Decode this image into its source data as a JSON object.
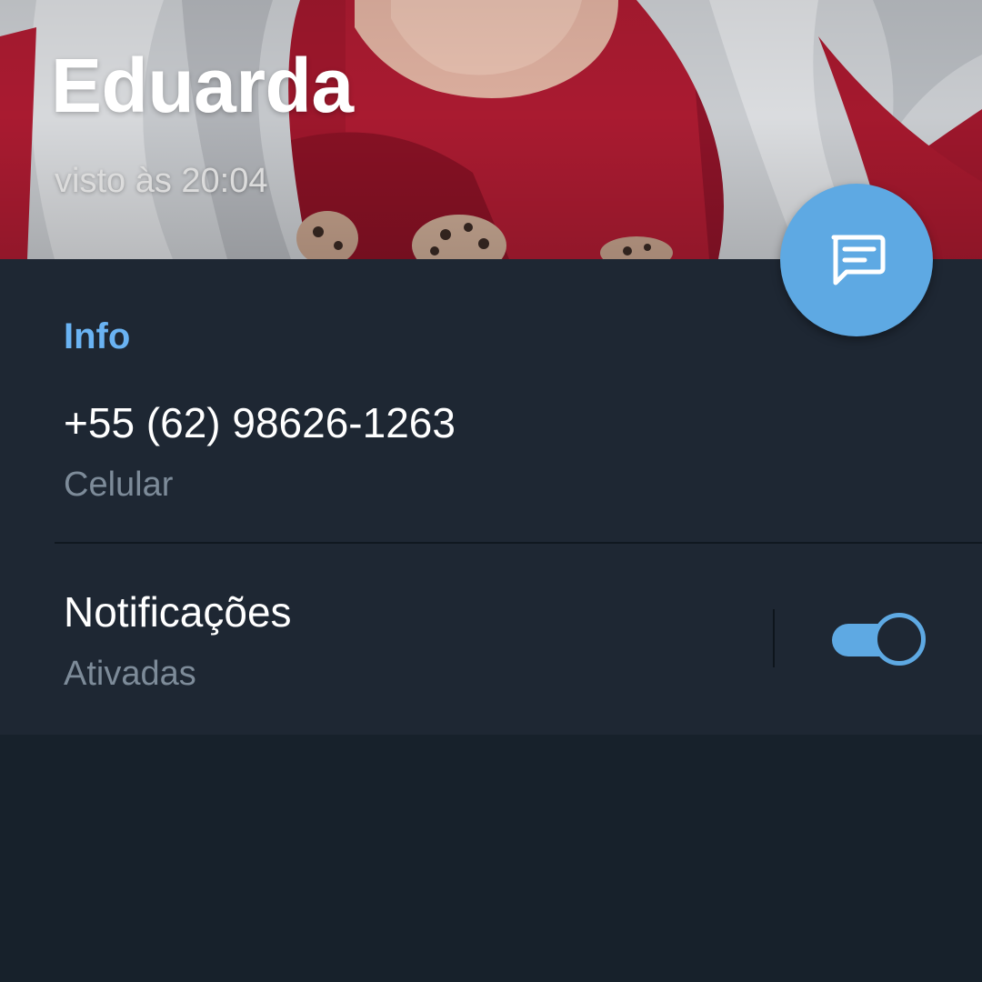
{
  "profile": {
    "name": "Eduarda",
    "status": "visto às 20:04"
  },
  "fab": {
    "icon": "message-icon"
  },
  "info": {
    "section_title": "Info",
    "phone": {
      "value": "+55 (62) 98626-1263",
      "label": "Celular"
    },
    "notifications": {
      "title": "Notificações",
      "state": "Ativadas",
      "enabled": true
    }
  },
  "colors": {
    "accent": "#5ea9e3",
    "section_header": "#6ab3f3",
    "card_background": "#1e2733",
    "page_background": "#17212b",
    "secondary_text": "#7d8b99"
  }
}
